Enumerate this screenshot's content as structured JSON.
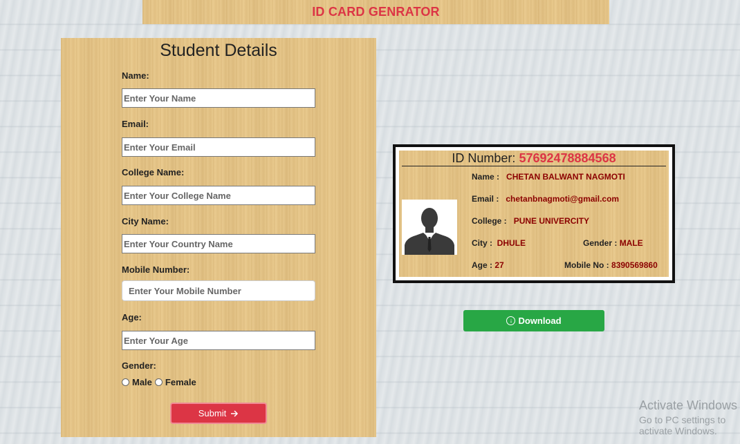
{
  "header": {
    "title": "ID CARD GENRATOR"
  },
  "form": {
    "title": "Student Details",
    "fields": [
      {
        "label": "Name:",
        "placeholder": "Enter Your Name"
      },
      {
        "label": "Email:",
        "placeholder": "Enter Your Email"
      },
      {
        "label": "College Name:",
        "placeholder": "Enter Your College Name"
      },
      {
        "label": "City Name:",
        "placeholder": "Enter Your Country Name"
      },
      {
        "label": "Mobile Number:",
        "placeholder": "Enter Your Mobile Number"
      },
      {
        "label": "Age:",
        "placeholder": "Enter Your Age"
      }
    ],
    "gender_label": "Gender:",
    "gender_options": [
      "Male",
      "Female"
    ],
    "submit_label": "Submit",
    "submit_icon": "arrow-right-icon"
  },
  "card": {
    "id_label": "ID Number:",
    "id_number": "57692478884568",
    "name_label": "Name :",
    "name": "CHETAN BALWANT NAGMOTI",
    "email_label": "Email :",
    "email": "chetanbnagmoti@gmail.com",
    "college_label": "College :",
    "college": "PUNE UNIVERCITY",
    "city_label": "City  :",
    "city": "DHULE",
    "gender_label": "Gender :",
    "gender": "MALE",
    "age_label": "Age :",
    "age": "27",
    "mobile_label": "Mobile No :",
    "mobile": "8390569860",
    "photo_icon": "user-silhouette-icon"
  },
  "download": {
    "label": "Download",
    "icon": "download-circle-icon"
  },
  "watermark": {
    "line1": "Activate Windows",
    "line2": "Go to PC settings to activate Windows."
  },
  "colors": {
    "accent_red": "#dc3545",
    "value_red": "#8b0000",
    "download_green": "#28a745",
    "panel_wood": "#e8c88c"
  }
}
